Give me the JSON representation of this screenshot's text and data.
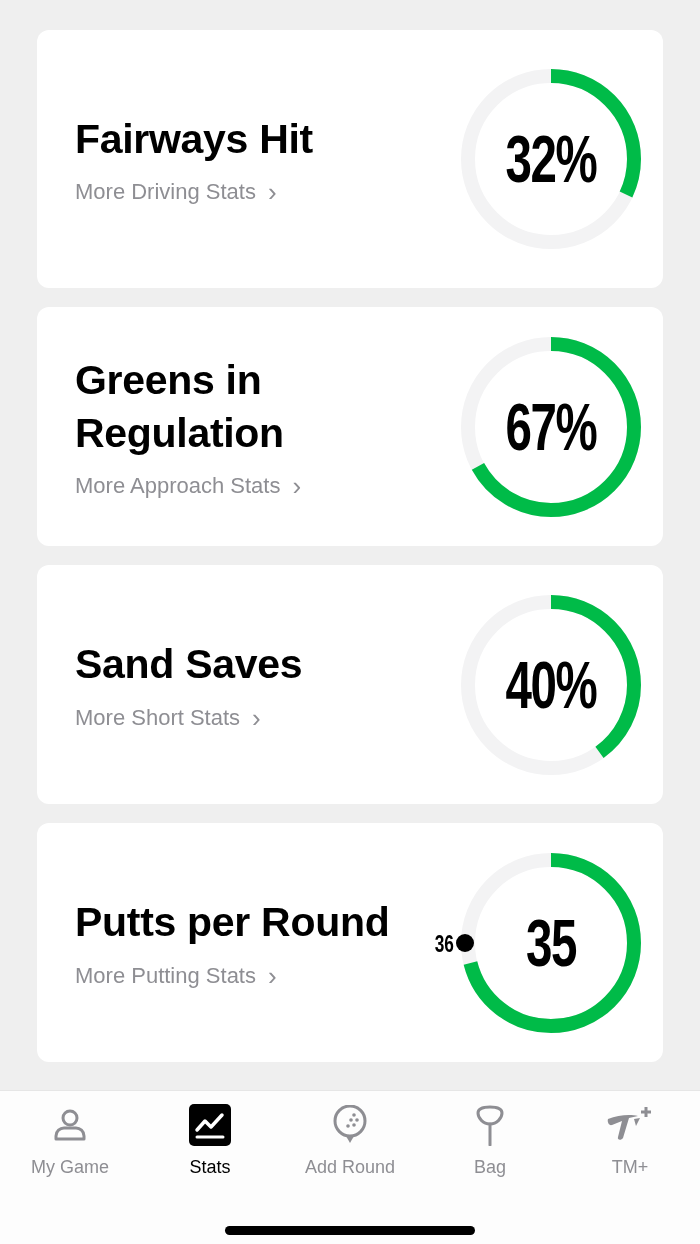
{
  "cards": [
    {
      "kind": "percent",
      "title": "Fairways Hit",
      "link": "More Driving Stats",
      "link_icon": "›",
      "value": "32%",
      "level": 0.32
    },
    {
      "kind": "percent",
      "title": "Greens in Regulation",
      "link": "More Approach Stats",
      "link_icon": "›",
      "value": "67%",
      "level": 0.67
    },
    {
      "kind": "percent",
      "title": "Sand Saves",
      "link": "More Short Stats",
      "link_icon": "›",
      "value": "40%",
      "level": 0.4
    },
    {
      "kind": "target",
      "title": "Putts per Round",
      "link": "More Putting Stats",
      "link_icon": "›",
      "value": "35",
      "level": 0.71,
      "target": "36"
    }
  ],
  "tabs": [
    {
      "kind": "person",
      "label": "My Game",
      "selected": false
    },
    {
      "kind": "chart",
      "label": "Stats",
      "selected": true
    },
    {
      "kind": "ball",
      "label": "Add Round",
      "selected": false
    },
    {
      "kind": "tee",
      "label": "Bag",
      "selected": false
    },
    {
      "kind": "logo",
      "label": "TM+",
      "selected": false
    }
  ]
}
